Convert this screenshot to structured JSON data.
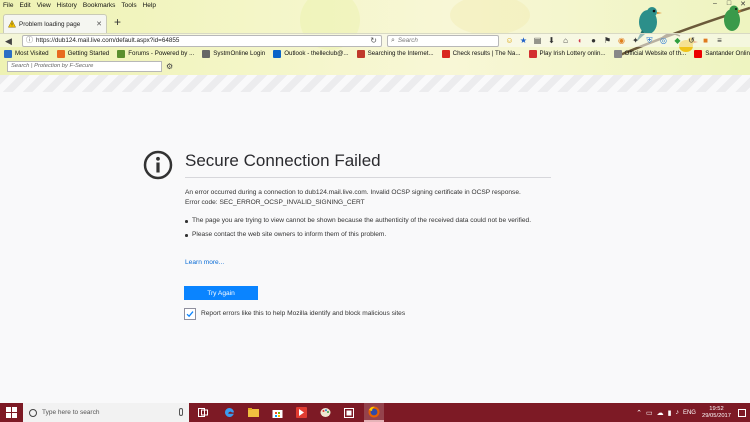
{
  "menubar": [
    "File",
    "Edit",
    "View",
    "History",
    "Bookmarks",
    "Tools",
    "Help"
  ],
  "tab": {
    "title": "Problem loading page",
    "new_tab_glyph": "+"
  },
  "navbar": {
    "url": "https://dub124.mail.live.com/default.aspx?id=64855",
    "search_placeholder": "Search"
  },
  "bookmarks": [
    {
      "label": "Most Visited",
      "color": "#2b6fc4"
    },
    {
      "label": "Getting Started",
      "color": "#e86a1f"
    },
    {
      "label": "Forums - Powered by ...",
      "color": "#5a8f2e"
    },
    {
      "label": "SystmOnline Login",
      "color": "#666666"
    },
    {
      "label": "Outlook - thelleclub@...",
      "color": "#0a64c8"
    },
    {
      "label": "Searching the Internet...",
      "color": "#c0392b"
    },
    {
      "label": "Check results | The Na...",
      "color": "#d9271e"
    },
    {
      "label": "Play Irish Lottery onlin...",
      "color": "#d32f2f"
    },
    {
      "label": "Official Website of th...",
      "color": "#888888"
    },
    {
      "label": "Santander Online Ban...",
      "color": "#ec0000"
    }
  ],
  "fsecure": {
    "placeholder": "Search | Protection by F-Secure"
  },
  "error": {
    "title": "Secure Connection Failed",
    "description": "An error occurred during a connection to dub124.mail.live.com. Invalid OCSP signing certificate in OCSP response.",
    "code": "Error code: SEC_ERROR_OCSP_INVALID_SIGNING_CERT",
    "bullets": [
      "The page you are trying to view cannot be shown because the authenticity of the received data could not be verified.",
      "Please contact the web site owners to inform them of this problem."
    ],
    "learn_more": "Learn more...",
    "try_again": "Try Again",
    "report_label": "Report errors like this to help Mozilla identify and block malicious sites",
    "report_checked": true
  },
  "taskbar": {
    "search_placeholder": "Type here to search",
    "language": "ENG",
    "time": "19:52",
    "date": "29/05/2017"
  },
  "colors": {
    "accent": "#0a84ff",
    "taskbar": "#7d1a25",
    "link": "#0a6cd6"
  }
}
